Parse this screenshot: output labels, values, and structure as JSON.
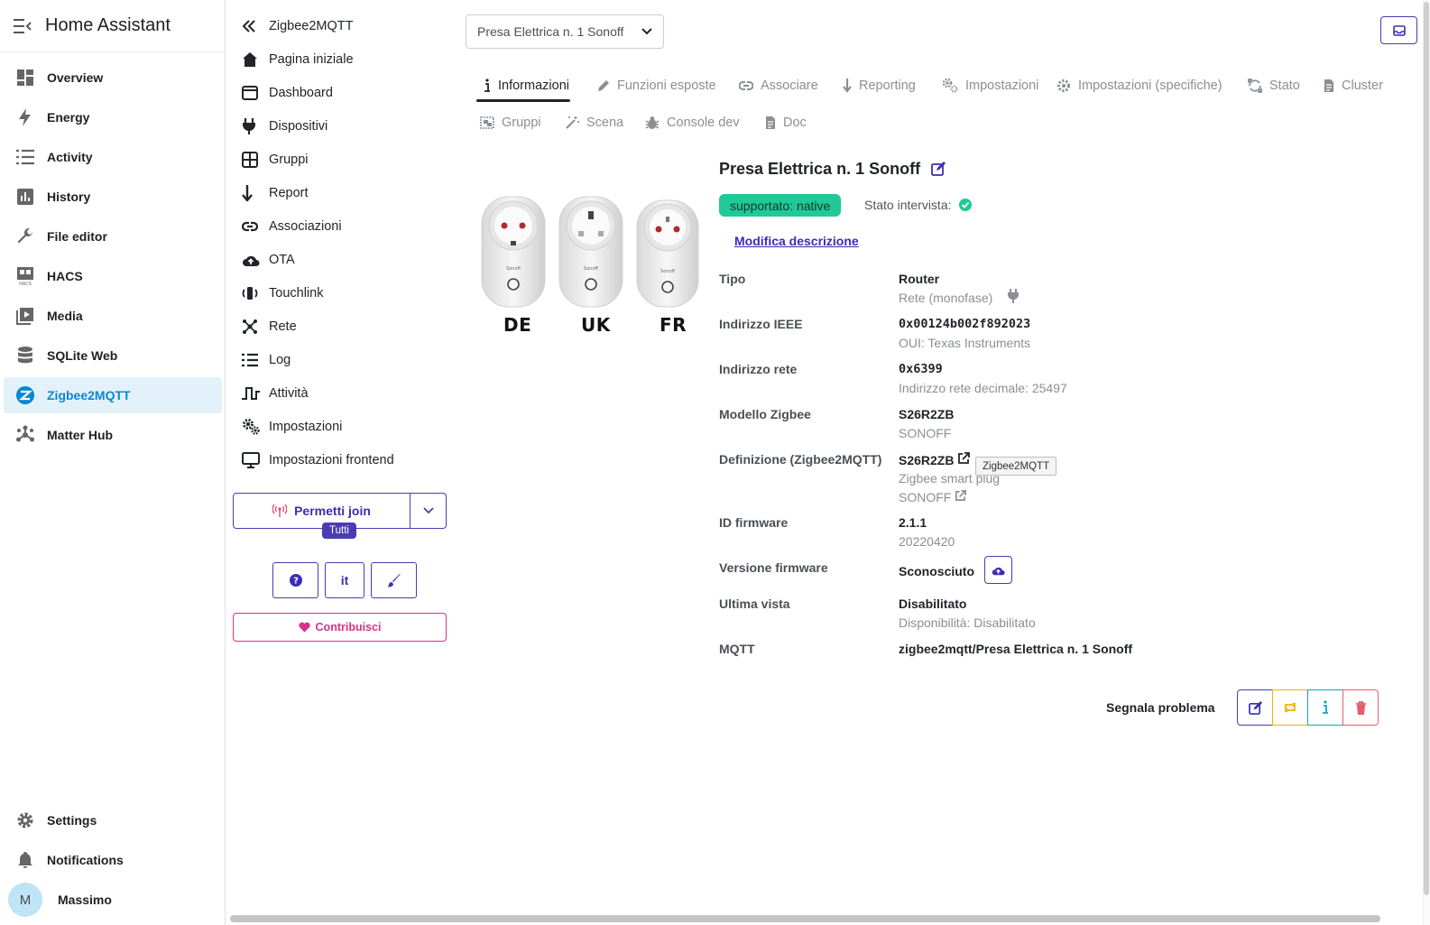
{
  "ha": {
    "title": "Home Assistant",
    "items": [
      {
        "label": "Overview"
      },
      {
        "label": "Energy"
      },
      {
        "label": "Activity"
      },
      {
        "label": "History"
      },
      {
        "label": "File editor"
      },
      {
        "label": "HACS"
      },
      {
        "label": "Media"
      },
      {
        "label": "SQLite Web"
      },
      {
        "label": "Zigbee2MQTT"
      },
      {
        "label": "Matter Hub"
      }
    ],
    "settings": "Settings",
    "notifications": "Notifications",
    "user": {
      "initial": "M",
      "name": "Massimo"
    },
    "accent": "#0b86cf"
  },
  "z2m_nav": {
    "title": "Zigbee2MQTT",
    "items": [
      {
        "label": "Pagina iniziale"
      },
      {
        "label": "Dashboard"
      },
      {
        "label": "Dispositivi"
      },
      {
        "label": "Gruppi"
      },
      {
        "label": "Report"
      },
      {
        "label": "Associazioni"
      },
      {
        "label": "OTA"
      },
      {
        "label": "Touchlink"
      },
      {
        "label": "Rete"
      },
      {
        "label": "Log"
      },
      {
        "label": "Attività"
      },
      {
        "label": "Impostazioni"
      },
      {
        "label": "Impostazioni frontend"
      }
    ],
    "permit_join": "Permetti join",
    "permit_join_target": "Tutti",
    "language": "it",
    "contribute": "Contribuisci",
    "primary": "#4a3bb3"
  },
  "device_select": {
    "value": "Presa Elettrica n. 1 Sonoff"
  },
  "tabs": [
    {
      "label": "Informazioni",
      "active": true
    },
    {
      "label": "Funzioni esposte"
    },
    {
      "label": "Associare"
    },
    {
      "label": "Reporting"
    },
    {
      "label": "Impostazioni"
    },
    {
      "label": "Impostazioni (specifiche)"
    },
    {
      "label": "Stato"
    },
    {
      "label": "Cluster"
    },
    {
      "label": "Gruppi"
    },
    {
      "label": "Scena"
    },
    {
      "label": "Console dev"
    },
    {
      "label": "Doc"
    }
  ],
  "device": {
    "image_labels": [
      "DE",
      "UK",
      "FR"
    ],
    "name": "Presa Elettrica n. 1 Sonoff",
    "support_badge": "supportato: native",
    "support_color": "#20c997",
    "interview_label": "Stato intervista:",
    "edit_description": "Modifica descrizione",
    "rows": {
      "type": {
        "label": "Tipo",
        "value": "Router",
        "sub": "Rete (monofase)"
      },
      "ieee": {
        "label": "Indirizzo IEEE",
        "value": "0x00124b002f892023",
        "sub": "OUI: Texas Instruments"
      },
      "network": {
        "label": "Indirizzo rete",
        "value": "0x6399",
        "sub": "Indirizzo rete decimale: 25497"
      },
      "model": {
        "label": "Modello Zigbee",
        "value": "S26R2ZB",
        "sub": "SONOFF"
      },
      "definition": {
        "label": "Definizione (Zigbee2MQTT)",
        "value": "S26R2ZB",
        "sub": "Zigbee smart plug",
        "vendor": "SONOFF",
        "tooltip": "Zigbee2MQTT"
      },
      "fw_id": {
        "label": "ID firmware",
        "value": "2.1.1",
        "sub": "20220420"
      },
      "fw_version": {
        "label": "Versione firmware",
        "value": "Sconosciuto"
      },
      "last_seen": {
        "label": "Ultima vista",
        "value": "Disabilitato",
        "sub": "Disponibilità: Disabilitato"
      },
      "mqtt": {
        "label": "MQTT",
        "value": "zigbee2mqtt/Presa Elettrica n. 1 Sonoff"
      }
    },
    "report_problem": "Segnala problema"
  }
}
